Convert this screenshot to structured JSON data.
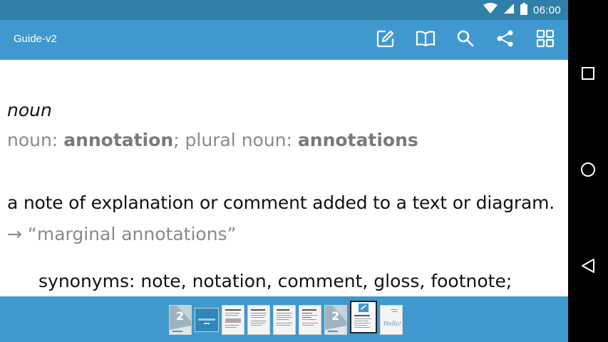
{
  "status": {
    "time": "06:00"
  },
  "appbar": {
    "title": "Guide-v2"
  },
  "toolbar": [
    {
      "name": "edit-button",
      "icon": "edit-icon"
    },
    {
      "name": "book-button",
      "icon": "book-icon"
    },
    {
      "name": "search-button",
      "icon": "search-icon"
    },
    {
      "name": "share-button",
      "icon": "share-icon"
    },
    {
      "name": "grid-button",
      "icon": "grid-icon"
    }
  ],
  "entry": {
    "pos": "noun",
    "forms_prefix": "noun: ",
    "forms_word": "annotation",
    "forms_mid": "; plural noun: ",
    "forms_plural": "annotations",
    "definition": "a note of explanation or comment added to a text or diagram.",
    "example": "→ “marginal annotations”",
    "synonyms": "synonyms: note, notation, comment, gloss, footnote;"
  },
  "thumbnails": {
    "count": 9,
    "selected_index": 7,
    "cover_numeral": "2",
    "last_page_text": "Hello!"
  },
  "colors": {
    "statusbar": "#2f7fa8",
    "appbar": "#3f99cf",
    "accent": "#3f99cf"
  }
}
